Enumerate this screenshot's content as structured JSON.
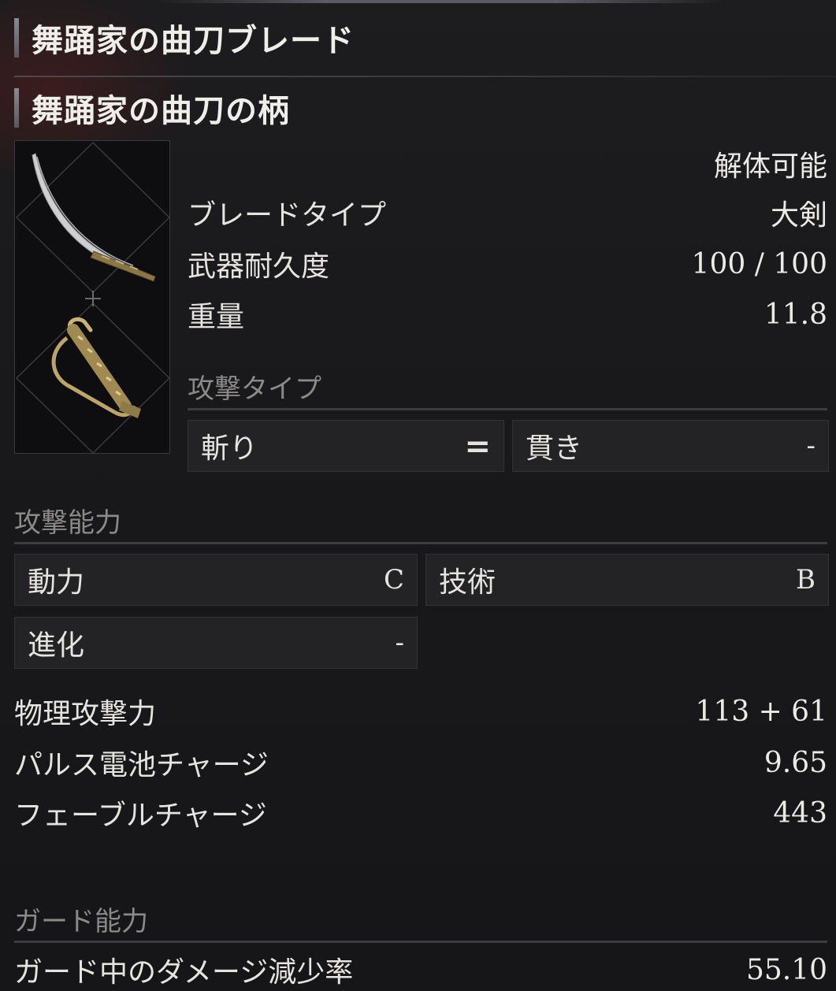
{
  "header": {
    "title_blade": "舞踊家の曲刀ブレード",
    "title_handle": "舞踊家の曲刀の柄"
  },
  "preview": {
    "blade_icon": "curved-saber-blade-icon",
    "handle_icon": "saber-handle-icon",
    "plus_icon": "plus-icon"
  },
  "info": {
    "disassemble": "解体可能",
    "rows": [
      {
        "label": "ブレードタイプ",
        "value": "大剣"
      },
      {
        "label": "武器耐久度",
        "value": "100 / 100"
      },
      {
        "label": "重量",
        "value": "11.8"
      }
    ]
  },
  "attack_type": {
    "heading": "攻撃タイプ",
    "slash_label": "斬り",
    "slash_value": "=",
    "pierce_label": "貫き",
    "pierce_value": "-"
  },
  "attack_ability": {
    "heading": "攻撃能力",
    "motivity_label": "動力",
    "motivity_value": "C",
    "technique_label": "技術",
    "technique_value": "B",
    "advance_label": "進化",
    "advance_value": "-"
  },
  "attack_stats": [
    {
      "label": "物理攻撃力",
      "value": "113 + 61"
    },
    {
      "label": "パルス電池チャージ",
      "value": "9.65"
    },
    {
      "label": "フェーブルチャージ",
      "value": "443"
    }
  ],
  "guard": {
    "heading": "ガード能力",
    "damage_reduction_label": "ガード中のダメージ減少率",
    "damage_reduction_value": "55.10"
  }
}
